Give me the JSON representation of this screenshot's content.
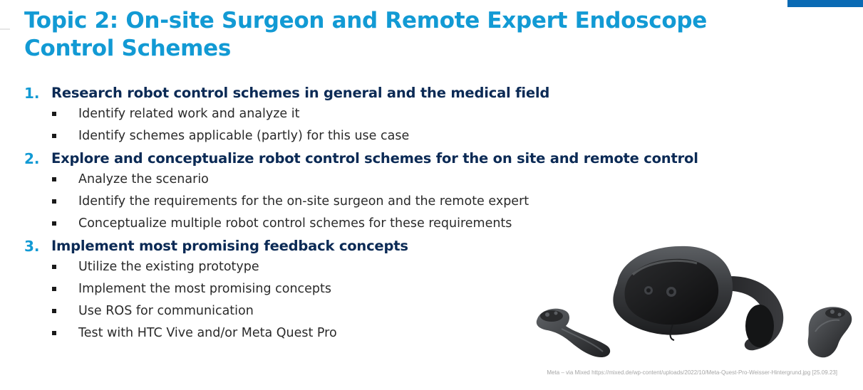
{
  "slide": {
    "title": "Topic 2: On-site Surgeon and Remote Expert Endoscope Control Schemes",
    "accent_color": "#129ad4",
    "heading_color": "#0b2a55",
    "corner_color": "#0a6ab4"
  },
  "sections": [
    {
      "number": "1.",
      "title": "Research robot control schemes in general and the medical field",
      "bullets": [
        "Identify related work and analyze it",
        "Identify schemes applicable (partly) for this use case"
      ]
    },
    {
      "number": "2.",
      "title": "Explore and conceptualize robot control schemes for the on site and remote control",
      "bullets": [
        "Analyze the scenario",
        "Identify the requirements for the on-site surgeon and the remote expert",
        "Conceptualize multiple robot control schemes for these requirements"
      ]
    },
    {
      "number": "3.",
      "title": "Implement most promising feedback concepts",
      "bullets": [
        "Utilize the existing prototype",
        "Implement the most promising concepts",
        "Use ROS for communication",
        "Test with HTC Vive and/or Meta Quest Pro"
      ]
    }
  ],
  "image": {
    "icon": "vr-headset-with-controllers-icon",
    "caption": "Meta – via Mixed https://mixed.de/wp-content/uploads/2022/10/Meta-Quest-Pro-Weisser-Hintergrund.jpg [25.09.23]"
  }
}
